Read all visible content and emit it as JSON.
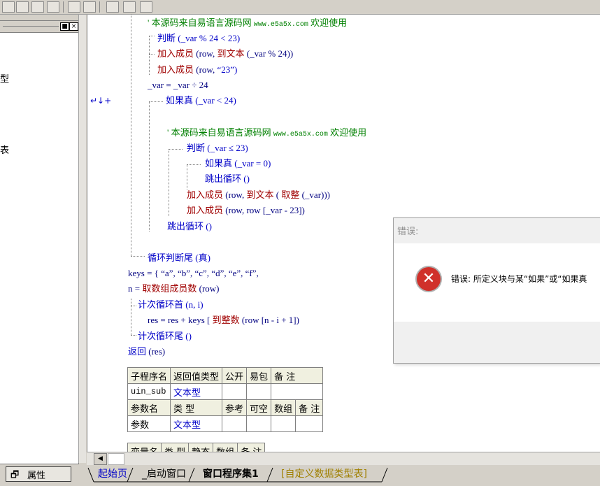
{
  "left_panel": {
    "fragment_1": "型",
    "fragment_2": "表",
    "window_buttons": [
      "■",
      "×"
    ]
  },
  "gutter": {
    "marker": "↵↓+"
  },
  "code": {
    "l1_comment": "' 本源码来自易语言源码网",
    "l1_url": "www.e5a5x.com",
    "l1_welcome": "欢迎使用",
    "l2": "判断 (_var % 24 < 23)",
    "l3a": "加入成员",
    "l3b": "(row, ",
    "l3c": "到文本",
    "l3d": "(_var % 24))",
    "l4a": "加入成员",
    "l4b": "(row, ",
    "l4c": "“23”)",
    "l5": "_var = _var ÷ 24",
    "l6": "如果真 (_var < 24)",
    "l7_comment": "' 本源码来自易语言源码网",
    "l7_url": "www.e5a5x.com",
    "l7_welcome": "欢迎使用",
    "l8": "判断 (_var ≤ 23)",
    "l9": "如果真 (_var = 0)",
    "l10": "跳出循环 ()",
    "l11a": "加入成员",
    "l11b": "(row, ",
    "l11c": "到文本",
    "l11d": "(",
    "l11e": "取整",
    "l11f": "(_var)))",
    "l12a": "加入成员",
    "l12b": "(row, row [_var - 23])",
    "l13": "跳出循环 ()",
    "l14": "循环判断尾 (真)",
    "l15": "keys = { “a”, “b”, “c”, “d”, “e”, “f”,",
    "l16a": "n = ",
    "l16b": "取数组成员数",
    "l16c": "(row)",
    "l17": "计次循环首 (n, i)",
    "l18a": "res = res + keys [",
    "l18b": "到整数",
    "l18c": "(row [n - i + 1])",
    "l19": "计次循环尾 ()",
    "l20a": "返回",
    "l20b": "(res)"
  },
  "sub_table": {
    "header": [
      "子程序名",
      "返回值类型",
      "公开",
      "易包",
      "备 注"
    ],
    "row": [
      "uin_sub",
      "文本型",
      "",
      "",
      ""
    ]
  },
  "param_table": {
    "header": [
      "参数名",
      "类 型",
      "参考",
      "可空",
      "数组",
      "备 注"
    ],
    "row": [
      "参数",
      "文本型",
      "",
      "",
      "",
      ""
    ]
  },
  "var_table_partial": {
    "header": [
      "变量名",
      "类 型",
      "静态",
      "数组",
      "备 注"
    ]
  },
  "dialog": {
    "title": "错误:",
    "message": "错误: 所定义块与某“如果”或“如果真",
    "icon": "error-icon"
  },
  "statusbar": {
    "property_button": "属性",
    "tabs": [
      "起始页",
      "_启动窗口",
      "窗口程序集1",
      "[自定义数据类型表]"
    ]
  },
  "colors": {
    "comment": "#008000",
    "keyword": "#0000c8",
    "function": "#a00000",
    "error": "#d0302a"
  }
}
